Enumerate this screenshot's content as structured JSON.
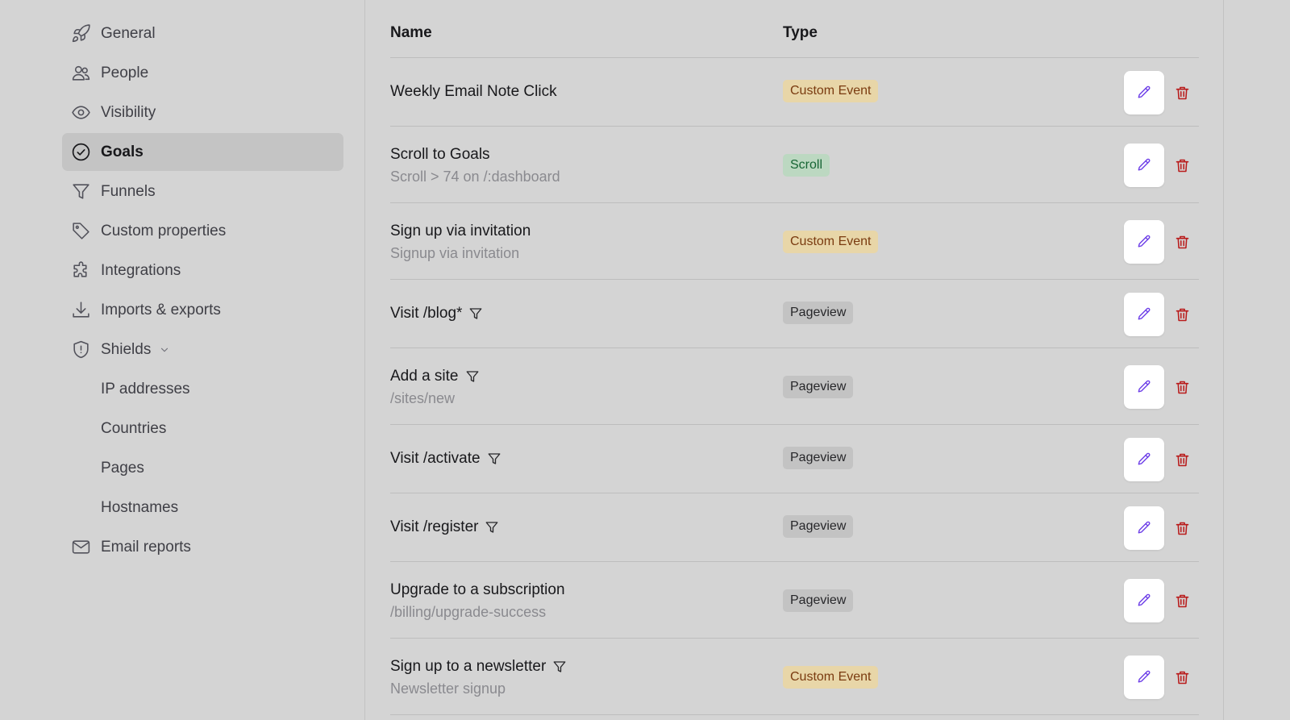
{
  "sidebar": {
    "items": [
      {
        "label": "General",
        "icon": "rocket-icon"
      },
      {
        "label": "People",
        "icon": "users-icon"
      },
      {
        "label": "Visibility",
        "icon": "eye-icon"
      },
      {
        "label": "Goals",
        "icon": "check-circle-icon",
        "active": true
      },
      {
        "label": "Funnels",
        "icon": "funnel-icon"
      },
      {
        "label": "Custom properties",
        "icon": "tag-icon"
      },
      {
        "label": "Integrations",
        "icon": "puzzle-icon"
      },
      {
        "label": "Imports & exports",
        "icon": "download-icon"
      },
      {
        "label": "Shields",
        "icon": "shield-icon",
        "expanded": true
      },
      {
        "label": "IP addresses"
      },
      {
        "label": "Countries"
      },
      {
        "label": "Pages"
      },
      {
        "label": "Hostnames"
      },
      {
        "label": "Email reports",
        "icon": "envelope-icon"
      }
    ]
  },
  "table": {
    "headers": {
      "name": "Name",
      "type": "Type"
    },
    "rows": [
      {
        "name": "Weekly Email Note Click",
        "sub": "",
        "funnel": false,
        "type": "Custom Event"
      },
      {
        "name": "Scroll to Goals",
        "sub": "Scroll > 74 on /:dashboard",
        "funnel": false,
        "type": "Scroll"
      },
      {
        "name": "Sign up via invitation",
        "sub": "Signup via invitation",
        "funnel": false,
        "type": "Custom Event"
      },
      {
        "name": "Visit /blog*",
        "sub": "",
        "funnel": true,
        "type": "Pageview"
      },
      {
        "name": "Add a site",
        "sub": "/sites/new",
        "funnel": true,
        "type": "Pageview"
      },
      {
        "name": "Visit /activate",
        "sub": "",
        "funnel": true,
        "type": "Pageview"
      },
      {
        "name": "Visit /register",
        "sub": "",
        "funnel": true,
        "type": "Pageview"
      },
      {
        "name": "Upgrade to a subscription",
        "sub": "/billing/upgrade-success",
        "funnel": false,
        "type": "Pageview"
      },
      {
        "name": "Sign up to a newsletter",
        "sub": "Newsletter signup",
        "funnel": true,
        "type": "Custom Event"
      }
    ]
  },
  "colors": {
    "edit_icon": "#6d3ee8",
    "delete_icon": "#b91c1c"
  }
}
